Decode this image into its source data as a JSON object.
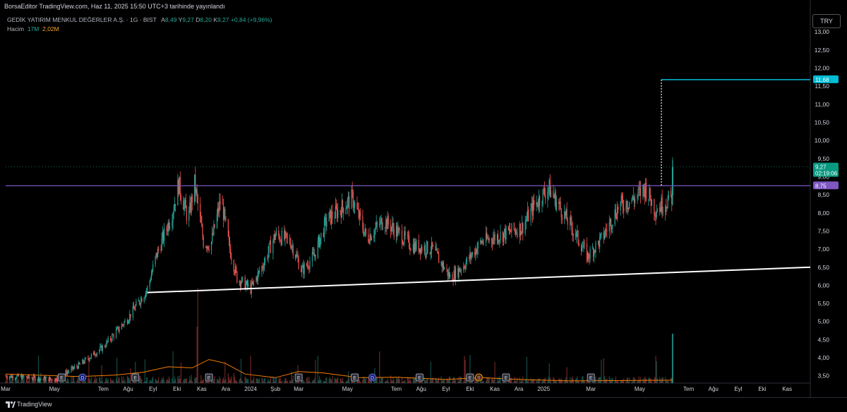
{
  "header": {
    "published": "BorsaEditor TradingView.com, Haz 11, 2025 15:50 UTC+3 tarihinde yayınlandı"
  },
  "legend": {
    "symbol": "GEDİK YATIRIM MENKUL DEĞERLER A.Ş. · 1G · BIST",
    "ohlc": [
      {
        "key": "A",
        "value": "8,49"
      },
      {
        "key": "Y",
        "value": "9,27"
      },
      {
        "key": "D",
        "value": "8,20"
      },
      {
        "key": "K",
        "value": "9,27"
      }
    ],
    "change": "+0,84 (+9,96%)",
    "volume_label": "Hacim",
    "volume_value": "17M",
    "volume_ma": "2,02M"
  },
  "currency": "TRY",
  "footer": {
    "brand": "TradingView"
  },
  "chart_data": {
    "type": "candlestick",
    "y_axis": {
      "min": 3.3,
      "max": 13.1,
      "ticks": [
        "13,00",
        "12,50",
        "12,00",
        "11,50",
        "11,00",
        "10,50",
        "10,00",
        "9,50",
        "9,00",
        "8,50",
        "8,00",
        "7,50",
        "7,00",
        "6,50",
        "6,00",
        "5,50",
        "5,00",
        "4,50",
        "4,00",
        "3,50"
      ]
    },
    "x_axis": {
      "start": "2023-03-01",
      "end": "2025-11-30",
      "ticks": [
        {
          "label": "Mar",
          "date": "2023-03-01"
        },
        {
          "label": "May",
          "date": "2023-05-01"
        },
        {
          "label": "Tem",
          "date": "2023-07-01"
        },
        {
          "label": "Ağu",
          "date": "2023-08-01"
        },
        {
          "label": "Eyl",
          "date": "2023-09-01"
        },
        {
          "label": "Eki",
          "date": "2023-10-01"
        },
        {
          "label": "Kas",
          "date": "2023-11-01"
        },
        {
          "label": "Ara",
          "date": "2023-12-01"
        },
        {
          "label": "2024",
          "date": "2024-01-01"
        },
        {
          "label": "Şub",
          "date": "2024-02-01"
        },
        {
          "label": "Mar",
          "date": "2024-03-01"
        },
        {
          "label": "May",
          "date": "2024-05-01"
        },
        {
          "label": "Tem",
          "date": "2024-07-01"
        },
        {
          "label": "Ağu",
          "date": "2024-08-01"
        },
        {
          "label": "Eyl",
          "date": "2024-09-01"
        },
        {
          "label": "Eki",
          "date": "2024-10-01"
        },
        {
          "label": "Kas",
          "date": "2024-11-01"
        },
        {
          "label": "Ara",
          "date": "2024-12-01"
        },
        {
          "label": "2025",
          "date": "2025-01-01"
        },
        {
          "label": "Mar",
          "date": "2025-03-01"
        },
        {
          "label": "May",
          "date": "2025-05-01"
        },
        {
          "label": "Tem",
          "date": "2025-07-01"
        },
        {
          "label": "Ağu",
          "date": "2025-08-01"
        },
        {
          "label": "Eyl",
          "date": "2025-09-01"
        },
        {
          "label": "Eki",
          "date": "2025-10-01"
        },
        {
          "label": "Kas",
          "date": "2025-11-01"
        }
      ]
    },
    "price_path": [
      [
        "2023-03-01",
        3.5
      ],
      [
        "2023-05-01",
        3.4
      ],
      [
        "2023-06-01",
        3.8
      ],
      [
        "2023-07-01",
        4.3
      ],
      [
        "2023-08-01",
        5.1
      ],
      [
        "2023-08-25",
        5.9
      ],
      [
        "2023-09-05",
        6.8
      ],
      [
        "2023-09-25",
        8.0
      ],
      [
        "2023-10-03",
        8.8
      ],
      [
        "2023-10-15",
        7.8
      ],
      [
        "2023-10-23",
        8.8
      ],
      [
        "2023-11-03",
        7.2
      ],
      [
        "2023-11-12",
        7.1
      ],
      [
        "2023-11-25",
        8.4
      ],
      [
        "2023-12-05",
        7.1
      ],
      [
        "2023-12-15",
        6.2
      ],
      [
        "2024-01-01",
        5.9
      ],
      [
        "2024-01-15",
        6.5
      ],
      [
        "2024-02-01",
        7.4
      ],
      [
        "2024-02-20",
        7.2
      ],
      [
        "2024-03-05",
        6.4
      ],
      [
        "2024-03-20",
        6.8
      ],
      [
        "2024-04-05",
        7.8
      ],
      [
        "2024-04-22",
        8.1
      ],
      [
        "2024-05-07",
        8.4
      ],
      [
        "2024-05-25",
        7.3
      ],
      [
        "2024-06-15",
        7.8
      ],
      [
        "2024-07-01",
        7.5
      ],
      [
        "2024-07-20",
        7.1
      ],
      [
        "2024-08-15",
        7.0
      ],
      [
        "2024-09-07",
        6.2
      ],
      [
        "2024-09-25",
        6.6
      ],
      [
        "2024-10-15",
        7.2
      ],
      [
        "2024-11-10",
        7.4
      ],
      [
        "2024-12-05",
        7.6
      ],
      [
        "2024-12-20",
        8.2
      ],
      [
        "2025-01-07",
        8.7
      ],
      [
        "2025-01-20",
        8.2
      ],
      [
        "2025-02-10",
        7.4
      ],
      [
        "2025-02-25",
        6.8
      ],
      [
        "2025-03-15",
        7.3
      ],
      [
        "2025-04-05",
        8.2
      ],
      [
        "2025-04-25",
        8.4
      ],
      [
        "2025-05-08",
        8.7
      ],
      [
        "2025-05-20",
        8.1
      ],
      [
        "2025-06-09",
        8.4
      ],
      [
        "2025-06-10",
        8.43
      ],
      [
        "2025-06-11",
        9.27
      ]
    ],
    "volume_ma_path": [
      [
        "2023-03-01",
        3.55
      ],
      [
        "2023-06-01",
        3.48
      ],
      [
        "2023-07-15",
        3.52
      ],
      [
        "2023-08-20",
        3.6
      ],
      [
        "2023-09-20",
        3.75
      ],
      [
        "2023-10-20",
        3.72
      ],
      [
        "2023-11-10",
        3.95
      ],
      [
        "2023-11-30",
        3.85
      ],
      [
        "2023-12-25",
        3.55
      ],
      [
        "2024-02-01",
        3.45
      ],
      [
        "2024-03-01",
        3.62
      ],
      [
        "2024-04-01",
        3.58
      ],
      [
        "2024-05-15",
        3.45
      ],
      [
        "2024-07-01",
        3.46
      ],
      [
        "2024-09-01",
        3.4
      ],
      [
        "2024-10-15",
        3.45
      ],
      [
        "2024-12-01",
        3.4
      ],
      [
        "2025-02-01",
        3.36
      ],
      [
        "2025-06-11",
        3.38
      ]
    ],
    "events": [
      {
        "label": "E",
        "date": "2023-05-10"
      },
      {
        "label": "D",
        "date": "2023-06-05",
        "kind": "dividend"
      },
      {
        "label": "E",
        "date": "2023-08-10"
      },
      {
        "label": "E",
        "date": "2023-11-10"
      },
      {
        "label": "E",
        "date": "2024-03-01"
      },
      {
        "label": "E",
        "date": "2024-05-10"
      },
      {
        "label": "D",
        "date": "2024-06-01",
        "kind": "dividend"
      },
      {
        "label": "E",
        "date": "2024-07-30"
      },
      {
        "label": "E",
        "date": "2024-10-01"
      },
      {
        "label": "S",
        "date": "2024-10-12",
        "kind": "split"
      },
      {
        "label": "E",
        "date": "2024-11-15"
      },
      {
        "label": "E",
        "date": "2025-03-01"
      }
    ],
    "annotations": {
      "resistance_level": 8.75,
      "target_level": 11.68,
      "target_start_date": "2025-05-28",
      "rising_trendline": [
        [
          "2023-08-25",
          5.8
        ],
        [
          "2025-11-30",
          6.5
        ]
      ],
      "current_price_level": 9.27
    },
    "price_labels": {
      "target": {
        "text": "11,68",
        "color": "#00bcd4"
      },
      "last": {
        "text": "9,27",
        "time": "02:19:06",
        "color": "#089981"
      },
      "resistance": {
        "text": "8,75",
        "color": "#7e57c2"
      }
    }
  }
}
